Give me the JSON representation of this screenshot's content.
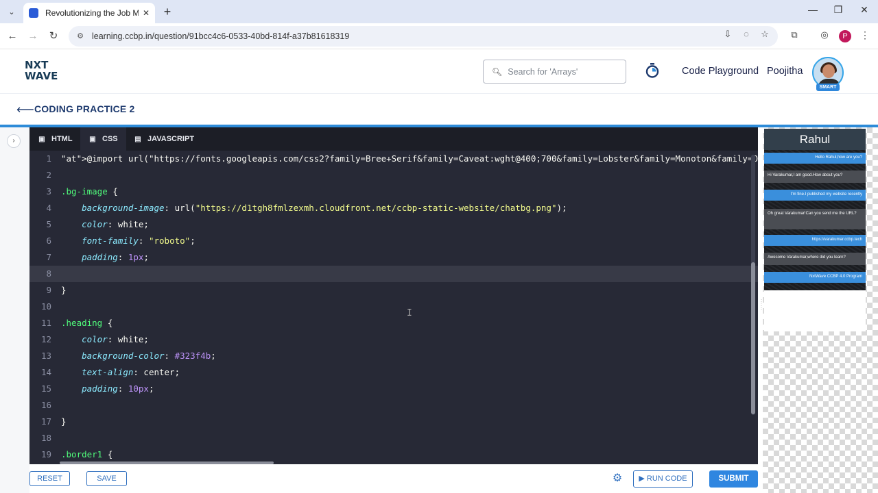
{
  "browser": {
    "tab_title": "Revolutionizing the Job Market",
    "url": "learning.ccbp.in/question/91bcc4c6-0533-40bd-814f-a37b81618319",
    "profile_initial": "P"
  },
  "header": {
    "logo_line1": "NXT",
    "logo_line2": "WAVE",
    "search_placeholder": "Search for 'Arrays'",
    "nav_code_playground": "Code Playground",
    "user_name": "Poojitha",
    "badge": "SMART"
  },
  "practice": {
    "title": "CODING PRACTICE 2"
  },
  "editor": {
    "tabs": [
      {
        "label": "HTML"
      },
      {
        "label": "CSS"
      },
      {
        "label": "JAVASCRIPT"
      }
    ],
    "active_tab": "CSS",
    "active_line": 8,
    "lines": [
      "@import url(\"https://fonts.googleapis.com/css2?family=Bree+Serif&family=Caveat:wght@400;700&family=Lobster&family=Monoton&family=Open+Sar",
      "",
      ".bg-image {",
      "    background-image: url(\"https://d1tgh8fmlzexmh.cloudfront.net/ccbp-static-website/chatbg.png\");",
      "    color: white;",
      "    font-family: \"roboto\";",
      "    padding: 1px;",
      "",
      "}",
      "",
      ".heading {",
      "    color: white;",
      "    background-color: #323f4b;",
      "    text-align: center;",
      "    padding: 10px;",
      "",
      "}",
      "",
      ".border1 {"
    ]
  },
  "toolbar": {
    "reset": "RESET",
    "save": "SAVE",
    "run_code": "RUN CODE",
    "submit": "SUBMIT"
  },
  "preview": {
    "heading": "Rahul",
    "messages": [
      {
        "side": "right",
        "text": "Hello Rahul,how are you?"
      },
      {
        "side": "left",
        "text": "Hi Varakumar,I am good.How about you?"
      },
      {
        "side": "right",
        "text": "I'm fine.I published my website recently"
      },
      {
        "side": "left",
        "text": "Oh great Varakumar!Can you send me the URL?"
      },
      {
        "side": "right",
        "text": "https://varakumar.ccbp.tech"
      },
      {
        "side": "left",
        "text": "Awesome Varakumar,where did you learn?"
      },
      {
        "side": "right",
        "text": "NxtWave CCBP 4.0 Program"
      }
    ]
  },
  "colors": {
    "accent": "#2d8bd8",
    "editor_bg": "#272936",
    "brand_dark": "#183b56"
  }
}
